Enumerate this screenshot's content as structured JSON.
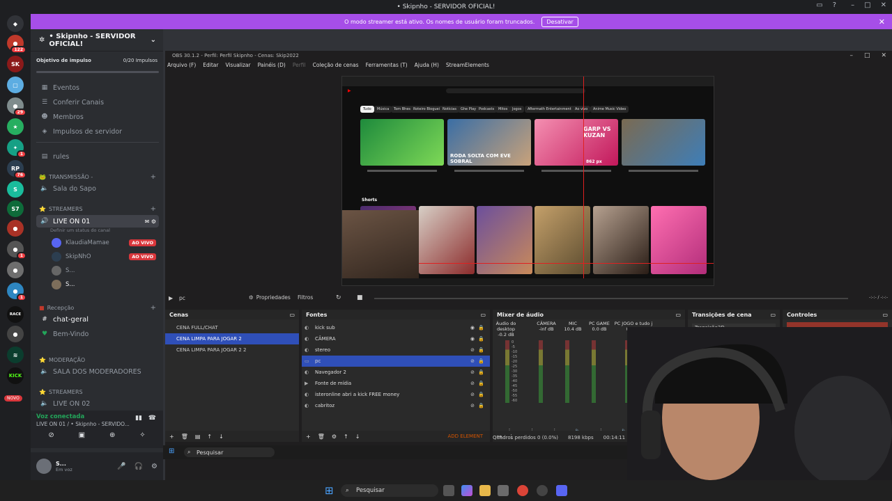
{
  "window": {
    "title": "• Skipnho - SERVIDOR OFICIAL!"
  },
  "banner": {
    "text": "O modo streamer está ativo. Os nomes de usuário foram truncados.",
    "button": "Desativar"
  },
  "rail": {
    "badges": [
      "122",
      "29",
      "1",
      "76",
      "1",
      "1"
    ],
    "new_label": "NOVO",
    "race_label": "RACE",
    "kick_label": "KICK"
  },
  "server": {
    "name": "• Skipnho - SERVIDOR OFICIAL!",
    "boost": {
      "label": "Objetivo de impulso",
      "count": "0/20 Impulsos"
    },
    "nav": [
      "Eventos",
      "Conferir Canais",
      "Membros",
      "Impulsos de servidor"
    ],
    "rules": "rules",
    "cat_transmissao": "TRANSMISSÃO -",
    "sala_sapo": "Sala do Sapo",
    "cat_streamers": "STREAMERS",
    "live_on_01": "LIVE ON 01",
    "live_status_hint": "Definir um status do canal",
    "users": [
      {
        "name": "KlaudiaMamae",
        "badge": "AO VIVO"
      },
      {
        "name": "SkipNhO",
        "badge": "AO VIVO"
      },
      {
        "name": "S...",
        "badge": ""
      },
      {
        "name": "S...",
        "badge": ""
      }
    ],
    "cat_recepcao": "Recepção",
    "chat_geral": "chat-geral",
    "bem_vindo": "Bem-Vindo",
    "cat_moderacao": "MODERAÇÃO",
    "sala_mods": "SALA DOS MODERADORES",
    "cat_streamers2": "STREAMERS",
    "live_on_02": "LIVE ON 02"
  },
  "voice": {
    "connected": "Voz conectada",
    "channel": "LIVE ON 01 / • Skipnho - SERVIDO..."
  },
  "user_panel": {
    "name": "S...",
    "status": "Em voz"
  },
  "obs": {
    "title": "OBS 30.1.2 - Perfil: Perfil Skipnho - Cenas: Skip2022",
    "menu": [
      "Arquivo (F)",
      "Editar",
      "Visualizar",
      "Painéis (D)",
      "Perfil",
      "Coleção de cenas",
      "Ferramentas (T)",
      "Ajuda (H)",
      "StreamElements"
    ],
    "source_label": "pc",
    "properties": "Propriedades",
    "filters": "Filtros",
    "time": "-:-:- / -:-:-",
    "scenes_title": "Cenas",
    "scenes": [
      "CENA FULL/CHAT",
      "CENA LIMPA PARA JOGAR 2",
      "CENA LIMPA PARA JOGAR 2 2"
    ],
    "sources_title": "Fontes",
    "sources": [
      "kick sub",
      "CÂMERA",
      "stereo",
      "pc",
      "Navegador 2",
      "Fonte de mídia",
      "isteronline abri a kick FREE money",
      "cabritoz"
    ],
    "add_element": "ADD ELEMENT",
    "mixer_title": "Mixer de áudio",
    "mixer": [
      {
        "name": "Áudio do desktop",
        "db": "-0.2 dB"
      },
      {
        "name": "CÂMERA",
        "db": "-inf dB"
      },
      {
        "name": "MIC",
        "db": "10.4 dB"
      },
      {
        "name": "PC GAME",
        "db": "0.0 dB"
      },
      {
        "name": "PC JOGO e tudo j",
        "db": "0.0 dB"
      }
    ],
    "meter_ticks": [
      "0",
      "-5",
      "-10",
      "-15",
      "-20",
      "-25",
      "-30",
      "-35",
      "-40",
      "-45",
      "-50",
      "-55",
      "-60"
    ],
    "transitions_title": "Transições de cena",
    "transition": "Transição3D",
    "controls_title": "Controles",
    "status": {
      "frames": "Quadros perdidos 0 (0.0%)",
      "kbps": "8198 kbps",
      "time": "00:14:11"
    }
  },
  "preview": {
    "chips": [
      "Tudo",
      "Música",
      "Tom Bhes",
      "Roteiro Blogueiras",
      "Notícias",
      "Ghe Plays",
      "Podcasts",
      "Mitos",
      "Jogos",
      "Aftermath Entertainment",
      "Ao vivo",
      "Anime Music Video"
    ],
    "thumbs": [
      "RODA SOLTA COM EVE SOBRAL",
      "GARP VS KUZAN",
      "862 px"
    ],
    "shorts": "Shorts"
  },
  "inner_taskbar": {
    "search": "Pesquisar"
  },
  "taskbar": {
    "search": "Pesquisar"
  }
}
